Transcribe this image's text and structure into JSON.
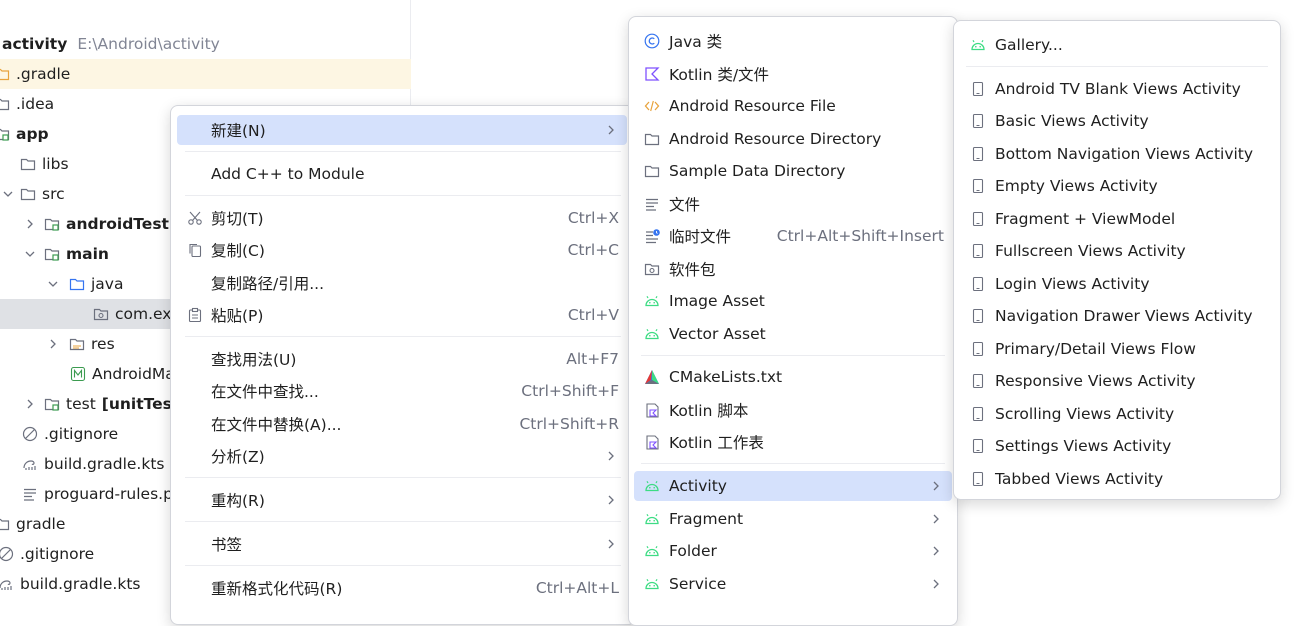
{
  "colors": {
    "highlight_row": "#fdf6e3",
    "selected_row": "#dfe1e5",
    "menu_active": "#d5e1fc",
    "android_green": "#3ddc84",
    "shortcut_gray": "#6c707e",
    "path_gray": "#818594"
  },
  "project_tree": {
    "root_label": "activity",
    "root_path": "E:\\Android\\activity",
    "items": [
      {
        "label": ".gradle",
        "icon": "folder-icon"
      },
      {
        "label": ".idea",
        "icon": "folder-icon"
      },
      {
        "label": "app",
        "icon": "module-folder-icon"
      },
      {
        "label": "libs",
        "icon": "folder-icon"
      },
      {
        "label": "src",
        "icon": "folder-icon"
      },
      {
        "label": "androidTest",
        "icon": "test-folder-icon"
      },
      {
        "label": "main",
        "icon": "source-folder-icon"
      },
      {
        "label": "java",
        "icon": "java-folder-icon"
      },
      {
        "label": "com.ex",
        "icon": "package-icon"
      },
      {
        "label": "res",
        "icon": "resource-folder-icon"
      },
      {
        "label": "AndroidMa",
        "icon": "manifest-icon"
      },
      {
        "label": "test",
        "label_suffix": "[unitTes",
        "icon": "test-folder-icon"
      },
      {
        "label": ".gitignore",
        "icon": "gitignore-icon"
      },
      {
        "label": "build.gradle.kts",
        "icon": "gradle-icon"
      },
      {
        "label": "proguard-rules.p",
        "icon": "text-file-icon"
      },
      {
        "label": "gradle",
        "icon": "folder-icon"
      },
      {
        "label": ".gitignore",
        "icon": "gitignore-icon"
      },
      {
        "label": "build.gradle.kts",
        "icon": "gradle-icon"
      }
    ]
  },
  "context_menu": {
    "items": [
      {
        "label": "新建(N)",
        "shortcut": "",
        "submenu": true
      },
      {
        "label": "Add C++ to Module",
        "shortcut": "",
        "submenu": false
      },
      {
        "label": "剪切(T)",
        "shortcut": "Ctrl+X",
        "icon": "scissors-icon"
      },
      {
        "label": "复制(C)",
        "shortcut": "Ctrl+C",
        "icon": "copy-icon"
      },
      {
        "label": "复制路径/引用...",
        "shortcut": ""
      },
      {
        "label": "粘贴(P)",
        "shortcut": "Ctrl+V",
        "icon": "paste-icon"
      },
      {
        "label": "查找用法(U)",
        "shortcut": "Alt+F7"
      },
      {
        "label": "在文件中查找...",
        "shortcut": "Ctrl+Shift+F"
      },
      {
        "label": "在文件中替换(A)...",
        "shortcut": "Ctrl+Shift+R"
      },
      {
        "label": "分析(Z)",
        "shortcut": "",
        "submenu": true
      },
      {
        "label": "重构(R)",
        "shortcut": "",
        "submenu": true
      },
      {
        "label": "书签",
        "shortcut": "",
        "submenu": true
      },
      {
        "label": "重新格式化代码(R)",
        "shortcut": "Ctrl+Alt+L"
      }
    ]
  },
  "new_submenu": {
    "items": [
      {
        "label": "Java 类",
        "icon": "java-class-icon"
      },
      {
        "label": "Kotlin 类/文件",
        "icon": "kotlin-icon"
      },
      {
        "label": "Android Resource File",
        "icon": "xml-code-icon"
      },
      {
        "label": "Android Resource Directory",
        "icon": "folder-icon"
      },
      {
        "label": "Sample Data Directory",
        "icon": "folder-icon"
      },
      {
        "label": "文件",
        "icon": "text-file-icon"
      },
      {
        "label": "临时文件",
        "shortcut": "Ctrl+Alt+Shift+Insert",
        "icon": "scratch-file-icon"
      },
      {
        "label": "软件包",
        "icon": "package-icon"
      },
      {
        "label": "Image Asset",
        "icon": "android-icon"
      },
      {
        "label": "Vector Asset",
        "icon": "android-icon"
      },
      {
        "label": "CMakeLists.txt",
        "icon": "cmake-icon"
      },
      {
        "label": "Kotlin 脚本",
        "icon": "kotlin-script-icon"
      },
      {
        "label": "Kotlin 工作表",
        "icon": "kotlin-script-icon"
      },
      {
        "label": "Activity",
        "icon": "android-icon",
        "submenu": true
      },
      {
        "label": "Fragment",
        "icon": "android-icon",
        "submenu": true
      },
      {
        "label": "Folder",
        "icon": "android-icon",
        "submenu": true
      },
      {
        "label": "Service",
        "icon": "android-icon",
        "submenu": true
      }
    ]
  },
  "activity_submenu": {
    "items": [
      {
        "label": "Gallery...",
        "icon": "android-icon"
      },
      {
        "label": "Android TV Blank Views Activity",
        "icon": "phone-icon"
      },
      {
        "label": "Basic Views Activity",
        "icon": "phone-icon"
      },
      {
        "label": "Bottom Navigation Views Activity",
        "icon": "phone-icon"
      },
      {
        "label": "Empty Views Activity",
        "icon": "phone-icon"
      },
      {
        "label": "Fragment + ViewModel",
        "icon": "phone-icon"
      },
      {
        "label": "Fullscreen Views Activity",
        "icon": "phone-icon"
      },
      {
        "label": "Login Views Activity",
        "icon": "phone-icon"
      },
      {
        "label": "Navigation Drawer Views Activity",
        "icon": "phone-icon"
      },
      {
        "label": "Primary/Detail Views Flow",
        "icon": "phone-icon"
      },
      {
        "label": "Responsive Views Activity",
        "icon": "phone-icon"
      },
      {
        "label": "Scrolling Views Activity",
        "icon": "phone-icon"
      },
      {
        "label": "Settings Views Activity",
        "icon": "phone-icon"
      },
      {
        "label": "Tabbed Views Activity",
        "icon": "phone-icon"
      }
    ]
  }
}
